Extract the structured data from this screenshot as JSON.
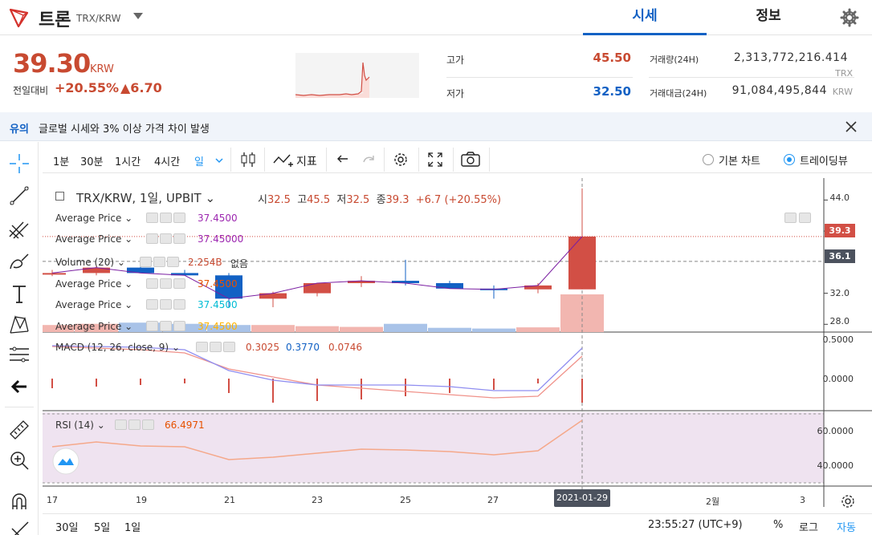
{
  "header": {
    "coin_name": "트론",
    "pair": "TRX/KRW",
    "tabs": [
      {
        "label": "시세"
      },
      {
        "label": "정보"
      }
    ]
  },
  "price": {
    "current": "39.30",
    "currency": "KRW",
    "change_label": "전일대비",
    "change_rate": "+20.55%",
    "change_amount": "▲6.70"
  },
  "stats": {
    "high_label": "고가",
    "high": "45.50",
    "low_label": "저가",
    "low": "32.50",
    "volume_label": "거래량(24H)",
    "volume": "2,313,772,216.414",
    "volume_unit": "TRX",
    "amount_label": "거래대금(24H)",
    "amount": "91,084,495,844",
    "amount_unit": "KRW"
  },
  "notice": {
    "tag": "유의",
    "text": "글로벌 시세와 3% 이상 가격 차이 발생"
  },
  "toolbar": {
    "timeframes": [
      {
        "label": "1분"
      },
      {
        "label": "30분"
      },
      {
        "label": "1시간"
      },
      {
        "label": "4시간"
      },
      {
        "label": "일"
      }
    ],
    "indicator_label": "지표",
    "view_basic": "기본 차트",
    "view_tv": "트레이딩뷰"
  },
  "chart": {
    "title": "TRX/KRW, 1일, UPBIT",
    "ohlc": {
      "o_label": "시",
      "o": "32.5",
      "h_label": "고",
      "h": "45.5",
      "l_label": "저",
      "l": "32.5",
      "c_label": "종",
      "c": "39.3",
      "change": "+6.7 (+20.55%)"
    },
    "overlays": [
      {
        "name": "Average Price",
        "value": "37.4500",
        "color": "#9c27b0"
      },
      {
        "name": "Average Price",
        "value": "37.45000",
        "color": "#9c27b0"
      },
      {
        "name": "Average Price",
        "value": "37.4500",
        "color": "#e65100"
      },
      {
        "name": "Average Price",
        "value": "37.4500",
        "color": "#00bcd4"
      },
      {
        "name": "Average Price",
        "value": "37.4500",
        "color": "#ffb300"
      }
    ],
    "volume_label": "Volume (20)",
    "volume_value": "2.254B",
    "volume_extra": "없음",
    "macd_label": "MACD (12, 26, close, 9)",
    "macd_values": [
      "0.3025",
      "0.3770",
      "0.0746"
    ],
    "rsi_label": "RSI (14)",
    "rsi_value": "66.4971",
    "price_axis": [
      "44.0",
      "40.0",
      "32.0",
      "28.0"
    ],
    "last_price_tag": "39.3",
    "cursor_price_tag": "36.1",
    "macd_axis": [
      "0.5000",
      "0.0000"
    ],
    "rsi_axis": [
      "60.0000",
      "40.0000"
    ],
    "x_axis": [
      "17",
      "19",
      "21",
      "23",
      "25",
      "27",
      "2월",
      "3"
    ],
    "cursor_date": "2021-01-29"
  },
  "chart_data": {
    "type": "candlestick",
    "x": [
      "01-17",
      "01-18",
      "01-19",
      "01-20",
      "01-21",
      "01-22",
      "01-23",
      "01-24",
      "01-25",
      "01-26",
      "01-27",
      "01-28",
      "01-29"
    ],
    "open": [
      34.6,
      34.6,
      35.3,
      34.6,
      34.3,
      31.3,
      32.0,
      33.3,
      33.6,
      33.3,
      32.6,
      32.5,
      32.5
    ],
    "high": [
      35.0,
      35.6,
      35.6,
      35.0,
      34.6,
      32.2,
      33.0,
      34.2,
      36.3,
      33.6,
      33.0,
      33.3,
      45.5
    ],
    "low": [
      34.2,
      34.3,
      34.8,
      34.3,
      30.2,
      30.2,
      31.6,
      32.8,
      33.0,
      32.8,
      31.3,
      32.0,
      32.5
    ],
    "close": [
      34.6,
      35.3,
      34.6,
      34.3,
      31.3,
      32.0,
      33.3,
      33.6,
      33.3,
      32.6,
      32.5,
      33.0,
      39.3
    ],
    "ylim": [
      27.0,
      46.0
    ]
  },
  "footer": {
    "ranges": [
      {
        "label": "30일"
      },
      {
        "label": "5일"
      },
      {
        "label": "1일"
      }
    ],
    "clock": "23:55:27 (UTC+9)",
    "percent": "%",
    "log": "로그",
    "auto": "자동"
  },
  "colors": {
    "up": "#d24f45",
    "down": "#1261c4",
    "accent": "#1261c4"
  }
}
